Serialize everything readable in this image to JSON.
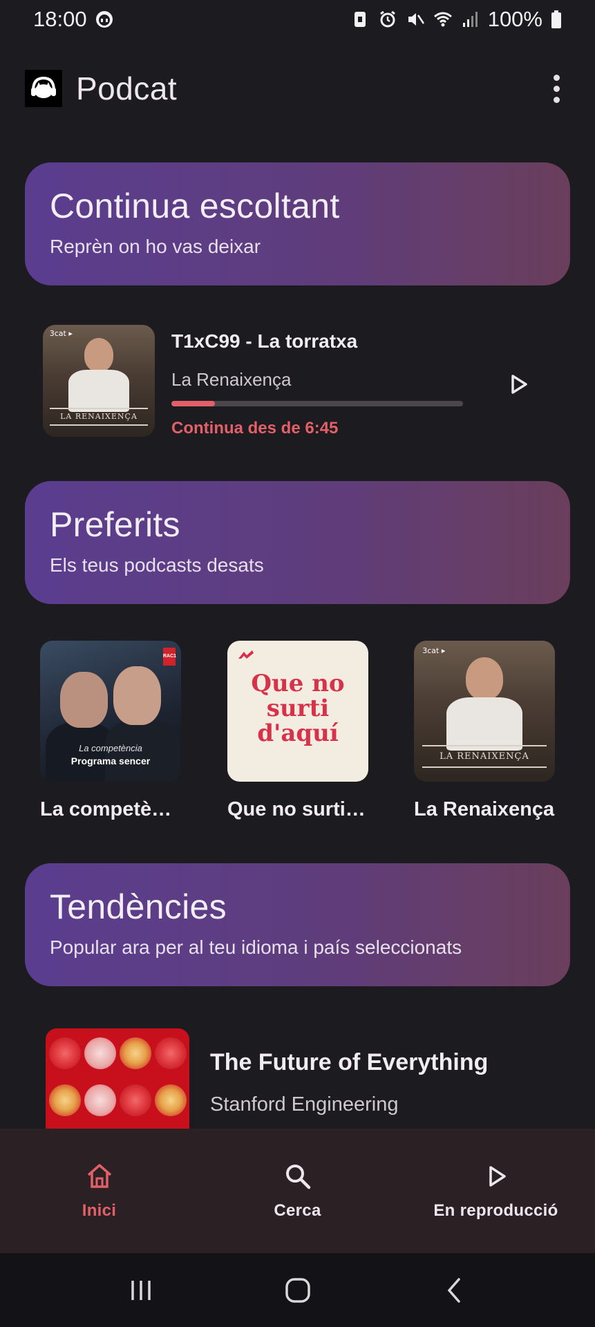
{
  "status_bar": {
    "time": "18:00",
    "battery": "100%"
  },
  "app_bar": {
    "title": "Podcat"
  },
  "continue_section": {
    "title": "Continua escoltant",
    "subtitle": "Reprèn on ho vas deixar"
  },
  "continue_episode": {
    "title": "T1xC99 - La torratxa",
    "show": "La Renaixença",
    "progress_fraction": 0.15,
    "resume_text": "Continua des de 6:45",
    "cover_banner": "LA RENAIXENÇA",
    "cover_tag": "3cat ▸"
  },
  "favorites_section": {
    "title": "Preferits",
    "subtitle": "Els teus podcasts desats"
  },
  "favorites": [
    {
      "label": "La competència",
      "cover_caption_top": "La competència",
      "cover_caption_bottom": "Programa sencer",
      "cover_badge": "RAC1"
    },
    {
      "label": "Que no surti d'aquí",
      "cover_text": "Que no surti d'aquí"
    },
    {
      "label": "La Renaixença",
      "cover_banner": "LA RENAIXENÇA",
      "cover_tag": "3cat ▸"
    }
  ],
  "trending_section": {
    "title": "Tendències",
    "subtitle": "Popular ara per al teu idioma i país seleccionats"
  },
  "trending": [
    {
      "title": "The Future of Everything",
      "author": "Stanford Engineering"
    }
  ],
  "bottom_nav": [
    {
      "label": "Inici",
      "icon": "home-icon",
      "active": true
    },
    {
      "label": "Cerca",
      "icon": "search-icon",
      "active": false
    },
    {
      "label": "En reproducció",
      "icon": "play-icon",
      "active": false
    }
  ],
  "colors": {
    "accent": "#E36069",
    "background": "#1c1b20",
    "card_gradient_start": "#5a3d8f",
    "card_gradient_end": "#6a3e5b",
    "nav_background": "#2b2124"
  }
}
